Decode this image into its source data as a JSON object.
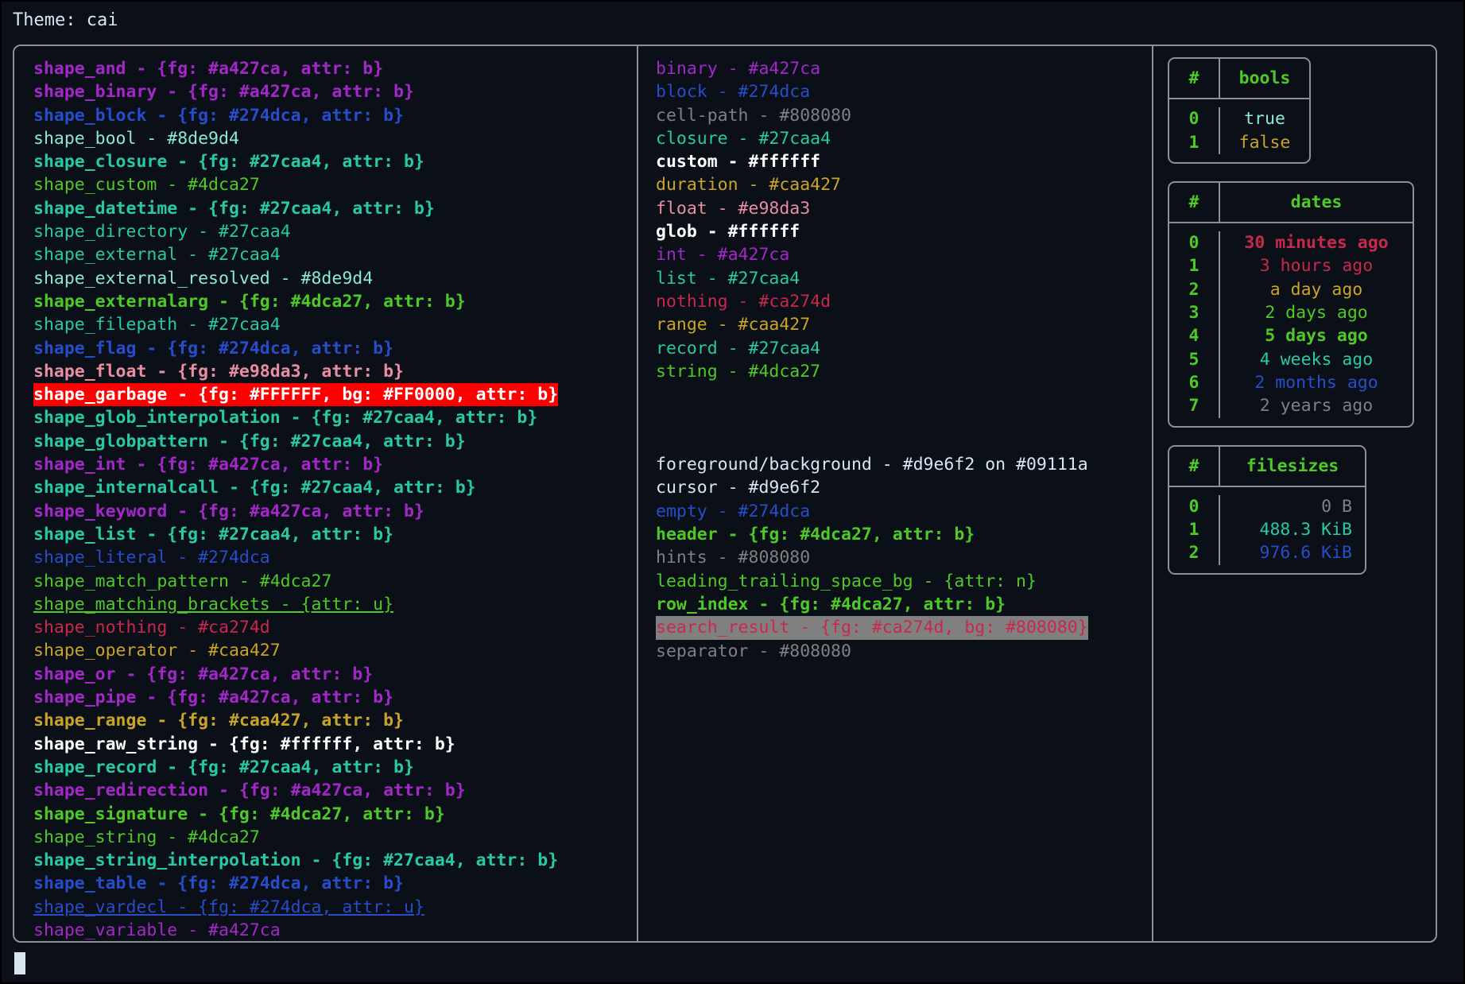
{
  "header": {
    "title": "Theme: cai"
  },
  "colors": {
    "background": "#0b0f17",
    "foreground": "#d9e6f2",
    "border": "#8a8f98",
    "cursor": "#d9e6f2",
    "magenta": "#a427ca",
    "blue": "#274dca",
    "cyan": "#8de9d4",
    "teal": "#27caa4",
    "green": "#4dca27",
    "pink": "#e98da3",
    "red": "#ca274d",
    "yellow": "#caa427",
    "white": "#ffffff",
    "gray": "#808080",
    "garbage_fg": "#FFFFFF",
    "garbage_bg": "#FF0000",
    "search_result_bg": "#808080"
  },
  "shapes_column": {
    "title": "shapes",
    "rows": [
      {
        "text": "shape_and - {fg: #a427ca, attr: b}",
        "fg": "#a427ca",
        "bold": true
      },
      {
        "text": "shape_binary - {fg: #a427ca, attr: b}",
        "fg": "#a427ca",
        "bold": true
      },
      {
        "text": "shape_block - {fg: #274dca, attr: b}",
        "fg": "#274dca",
        "bold": true
      },
      {
        "text": "shape_bool - #8de9d4",
        "fg": "#8de9d4",
        "bold": false
      },
      {
        "text": "shape_closure - {fg: #27caa4, attr: b}",
        "fg": "#27caa4",
        "bold": true
      },
      {
        "text": "shape_custom - #4dca27",
        "fg": "#4dca27",
        "bold": false
      },
      {
        "text": "shape_datetime - {fg: #27caa4, attr: b}",
        "fg": "#27caa4",
        "bold": true
      },
      {
        "text": "shape_directory - #27caa4",
        "fg": "#27caa4",
        "bold": false
      },
      {
        "text": "shape_external - #27caa4",
        "fg": "#27caa4",
        "bold": false
      },
      {
        "text": "shape_external_resolved - #8de9d4",
        "fg": "#8de9d4",
        "bold": false
      },
      {
        "text": "shape_externalarg - {fg: #4dca27, attr: b}",
        "fg": "#4dca27",
        "bold": true
      },
      {
        "text": "shape_filepath - #27caa4",
        "fg": "#27caa4",
        "bold": false
      },
      {
        "text": "shape_flag - {fg: #274dca, attr: b}",
        "fg": "#274dca",
        "bold": true
      },
      {
        "text": "shape_float - {fg: #e98da3, attr: b}",
        "fg": "#e98da3",
        "bold": true
      },
      {
        "text": "shape_garbage - {fg: #FFFFFF, bg: #FF0000, attr: b}",
        "fg": "#FFFFFF",
        "bg": "#FF0000",
        "bold": true
      },
      {
        "text": "shape_glob_interpolation - {fg: #27caa4, attr: b}",
        "fg": "#27caa4",
        "bold": true
      },
      {
        "text": "shape_globpattern - {fg: #27caa4, attr: b}",
        "fg": "#27caa4",
        "bold": true
      },
      {
        "text": "shape_int - {fg: #a427ca, attr: b}",
        "fg": "#a427ca",
        "bold": true
      },
      {
        "text": "shape_internalcall - {fg: #27caa4, attr: b}",
        "fg": "#27caa4",
        "bold": true
      },
      {
        "text": "shape_keyword - {fg: #a427ca, attr: b}",
        "fg": "#a427ca",
        "bold": true
      },
      {
        "text": "shape_list - {fg: #27caa4, attr: b}",
        "fg": "#27caa4",
        "bold": true
      },
      {
        "text": "shape_literal - #274dca",
        "fg": "#274dca",
        "bold": false
      },
      {
        "text": "shape_match_pattern - #4dca27",
        "fg": "#4dca27",
        "bold": false
      },
      {
        "text": "shape_matching_brackets - {attr: u}",
        "fg": "#4dca27",
        "bold": false,
        "underline": true
      },
      {
        "text": "shape_nothing - #ca274d",
        "fg": "#ca274d",
        "bold": false
      },
      {
        "text": "shape_operator - #caa427",
        "fg": "#caa427",
        "bold": false
      },
      {
        "text": "shape_or - {fg: #a427ca, attr: b}",
        "fg": "#a427ca",
        "bold": true
      },
      {
        "text": "shape_pipe - {fg: #a427ca, attr: b}",
        "fg": "#a427ca",
        "bold": true
      },
      {
        "text": "shape_range - {fg: #caa427, attr: b}",
        "fg": "#caa427",
        "bold": true
      },
      {
        "text": "shape_raw_string - {fg: #ffffff, attr: b}",
        "fg": "#ffffff",
        "bold": true
      },
      {
        "text": "shape_record - {fg: #27caa4, attr: b}",
        "fg": "#27caa4",
        "bold": true
      },
      {
        "text": "shape_redirection - {fg: #a427ca, attr: b}",
        "fg": "#a427ca",
        "bold": true
      },
      {
        "text": "shape_signature - {fg: #4dca27, attr: b}",
        "fg": "#4dca27",
        "bold": true
      },
      {
        "text": "shape_string - #4dca27",
        "fg": "#4dca27",
        "bold": false
      },
      {
        "text": "shape_string_interpolation - {fg: #27caa4, attr: b}",
        "fg": "#27caa4",
        "bold": true
      },
      {
        "text": "shape_table - {fg: #274dca, attr: b}",
        "fg": "#274dca",
        "bold": true
      },
      {
        "text": "shape_vardecl - {fg: #274dca, attr: u}",
        "fg": "#274dca",
        "bold": false,
        "underline": true
      },
      {
        "text": "shape_variable - #a427ca",
        "fg": "#a427ca",
        "bold": false
      }
    ]
  },
  "types_column": {
    "title": "types",
    "rows": [
      {
        "text": "binary - #a427ca",
        "fg": "#a427ca",
        "bold": false
      },
      {
        "text": "block - #274dca",
        "fg": "#274dca",
        "bold": false
      },
      {
        "text": "cell-path - #808080",
        "fg": "#808080",
        "bold": false
      },
      {
        "text": "closure - #27caa4",
        "fg": "#27caa4",
        "bold": false
      },
      {
        "text": "custom - #ffffff",
        "fg": "#ffffff",
        "bold": true
      },
      {
        "text": "duration - #caa427",
        "fg": "#caa427",
        "bold": false
      },
      {
        "text": "float - #e98da3",
        "fg": "#e98da3",
        "bold": false
      },
      {
        "text": "glob - #ffffff",
        "fg": "#ffffff",
        "bold": true
      },
      {
        "text": "int - #a427ca",
        "fg": "#a427ca",
        "bold": false
      },
      {
        "text": "list - #27caa4",
        "fg": "#27caa4",
        "bold": false
      },
      {
        "text": "nothing - #ca274d",
        "fg": "#ca274d",
        "bold": false
      },
      {
        "text": "range - #caa427",
        "fg": "#caa427",
        "bold": false
      },
      {
        "text": "record - #27caa4",
        "fg": "#27caa4",
        "bold": false
      },
      {
        "text": "string - #4dca27",
        "fg": "#4dca27",
        "bold": false
      }
    ]
  },
  "ui_column": {
    "title": "ui",
    "rows": [
      {
        "text": "foreground/background - #d9e6f2 on #09111a",
        "fg": "#d9e6f2",
        "bold": false
      },
      {
        "text": "cursor - #d9e6f2",
        "fg": "#d9e6f2",
        "bold": false
      },
      {
        "text": "empty - #274dca",
        "fg": "#274dca",
        "bold": false
      },
      {
        "text": "header - {fg: #4dca27, attr: b}",
        "fg": "#4dca27",
        "bold": true
      },
      {
        "text": "hints - #808080",
        "fg": "#808080",
        "bold": false
      },
      {
        "text": "leading_trailing_space_bg - {attr: n}",
        "fg": "#4dca27",
        "bold": false
      },
      {
        "text": "row_index - {fg: #4dca27, attr: b}",
        "fg": "#4dca27",
        "bold": true
      },
      {
        "text": "search_result - {fg: #ca274d, bg: #808080}",
        "fg": "#ca274d",
        "bg": "#808080",
        "bold": false
      },
      {
        "text": "separator - #808080",
        "fg": "#808080",
        "bold": false
      }
    ]
  },
  "tables": [
    {
      "name": "bools",
      "index_header": "#",
      "value_header": "bools",
      "align": "center",
      "rows": [
        {
          "index": "0",
          "value": "true",
          "fg": "#8de9d4"
        },
        {
          "index": "1",
          "value": "false",
          "fg": "#caa427"
        }
      ]
    },
    {
      "name": "dates",
      "index_header": "#",
      "value_header": "dates",
      "align": "center",
      "rows": [
        {
          "index": "0",
          "value": "30 minutes ago",
          "fg": "#ca274d",
          "bold": true
        },
        {
          "index": "1",
          "value": "3 hours ago",
          "fg": "#ca274d",
          "bold": false
        },
        {
          "index": "2",
          "value": "a day ago",
          "fg": "#caa427",
          "bold": false
        },
        {
          "index": "3",
          "value": "2 days ago",
          "fg": "#4dca27",
          "bold": false
        },
        {
          "index": "4",
          "value": "5 days ago",
          "fg": "#4dca27",
          "bold": true
        },
        {
          "index": "5",
          "value": "4 weeks ago",
          "fg": "#27caa4",
          "bold": false
        },
        {
          "index": "6",
          "value": "2 months ago",
          "fg": "#274dca",
          "bold": false
        },
        {
          "index": "7",
          "value": "2 years ago",
          "fg": "#808080",
          "bold": false
        }
      ]
    },
    {
      "name": "filesizes",
      "index_header": "#",
      "value_header": "filesizes",
      "align": "right",
      "rows": [
        {
          "index": "0",
          "value": "0 B",
          "fg": "#808080",
          "bold": false
        },
        {
          "index": "1",
          "value": "488.3 KiB",
          "fg": "#27caa4",
          "bold": false
        },
        {
          "index": "2",
          "value": "976.6 KiB",
          "fg": "#274dca",
          "bold": false
        }
      ]
    }
  ],
  "prompt": {
    "cursor_visible": true
  }
}
